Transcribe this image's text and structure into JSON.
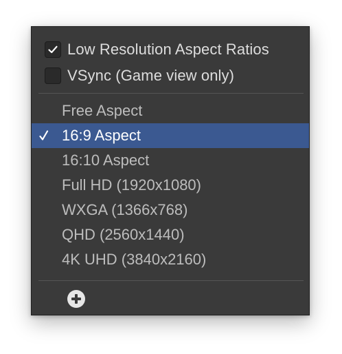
{
  "menu": {
    "toggles": [
      {
        "label": "Low Resolution Aspect Ratios",
        "checked": true
      },
      {
        "label": "VSync (Game view only)",
        "checked": false
      }
    ],
    "aspects": [
      {
        "label": "Free Aspect",
        "selected": false
      },
      {
        "label": "16:9 Aspect",
        "selected": true
      },
      {
        "label": "16:10 Aspect",
        "selected": false
      },
      {
        "label": "Full HD (1920x1080)",
        "selected": false
      },
      {
        "label": "WXGA (1366x768)",
        "selected": false
      },
      {
        "label": "QHD (2560x1440)",
        "selected": false
      },
      {
        "label": "4K UHD (3840x2160)",
        "selected": false
      }
    ],
    "add_button_icon": "plus-circle-icon"
  },
  "colors": {
    "menu_background": "#3a3a3a",
    "selection_highlight": "#3b5991",
    "text": "#dddddd",
    "text_dim": "#bdbdbd"
  }
}
